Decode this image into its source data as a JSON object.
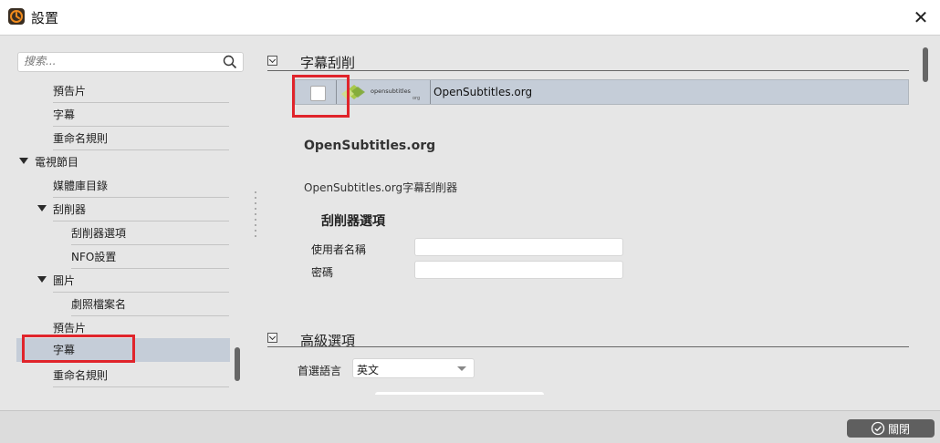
{
  "window": {
    "title": "設置",
    "close_glyph": "✕"
  },
  "sidebar": {
    "search_placeholder": "搜索...",
    "tree": [
      {
        "label": "預告片"
      },
      {
        "label": "字幕"
      },
      {
        "label": "重命名規則"
      },
      {
        "label": "電視節目",
        "expanded": true
      },
      {
        "label": "媒體庫目錄"
      },
      {
        "label": "刮削器",
        "expanded": true
      },
      {
        "label": "刮削器選項"
      },
      {
        "label": "NFO設置"
      },
      {
        "label": "圖片",
        "expanded": true
      },
      {
        "label": "劇照檔案名"
      },
      {
        "label": "預告片"
      },
      {
        "label": "字幕",
        "selected": true
      },
      {
        "label": "重命名規則"
      }
    ]
  },
  "subtitle_scraper": {
    "section_title": "字幕刮削",
    "row": {
      "enabled": false,
      "logo_text": "opensubtitles",
      "logo_subtext": "org",
      "name": "OpenSubtitles.org"
    },
    "info_title": "OpenSubtitles.org",
    "info_desc": "OpenSubtitles.org字幕刮削器",
    "options_title": "刮削器選項",
    "username_label": "使用者名稱",
    "username_value": "",
    "password_label": "密碼",
    "password_value": ""
  },
  "advanced": {
    "section_title": "高級選項",
    "language_label": "首選語言",
    "language_value": "英文"
  },
  "footer": {
    "close_label": "關閉"
  },
  "colors": {
    "highlight": "#e0242b",
    "selection": "#c5cdd8",
    "button": "#5f5f5f"
  }
}
